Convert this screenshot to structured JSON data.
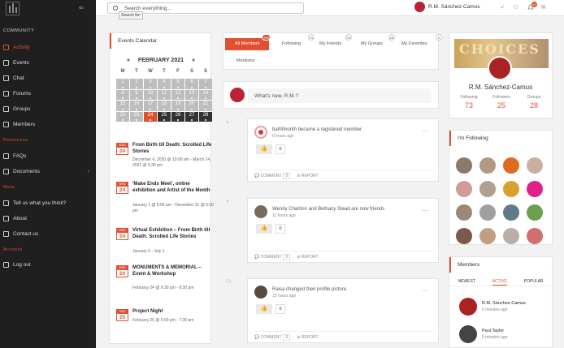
{
  "sidebar": {
    "sections": {
      "community": "COMMUNITY",
      "resources": "Resources",
      "more": "More",
      "account": "Account"
    },
    "items": [
      {
        "label": "Activity",
        "icon": "activity-icon"
      },
      {
        "label": "Events",
        "icon": "calendar-icon"
      },
      {
        "label": "Chat",
        "icon": "chat-icon"
      },
      {
        "label": "Forums",
        "icon": "forums-icon"
      },
      {
        "label": "Groups",
        "icon": "groups-icon"
      },
      {
        "label": "Members",
        "icon": "members-icon"
      },
      {
        "label": "FAQs",
        "icon": "faq-icon"
      },
      {
        "label": "Documents",
        "icon": "folder-icon"
      },
      {
        "label": "Tell us what you think?",
        "icon": "feedback-icon"
      },
      {
        "label": "About",
        "icon": "info-icon"
      },
      {
        "label": "Contact us",
        "icon": "contact-icon"
      },
      {
        "label": "Log out",
        "icon": "logout-icon"
      }
    ],
    "documents_chevron": "›",
    "menu_icon": "⇐"
  },
  "topbar": {
    "search_placeholder": "Search everything...",
    "tooltip": "Search for:",
    "user_name": "R.M. Sánchez-Camus",
    "notifications_badge": "42",
    "icons": {
      "check": "✓",
      "users": "⚇",
      "bell": "🔔",
      "mail": "✉"
    }
  },
  "calendar": {
    "title": "Events Calendar",
    "month": "FEBRUARY 2021",
    "prev": "«",
    "next": "»",
    "dow": [
      "M",
      "T",
      "W",
      "T",
      "F",
      "S",
      "S"
    ],
    "days": [
      "1",
      "2",
      "3",
      "4",
      "5",
      "6",
      "7",
      "8",
      "9",
      "10",
      "11",
      "12",
      "13",
      "14",
      "15",
      "16",
      "17",
      "18",
      "19",
      "20",
      "21",
      "22",
      "23",
      "24",
      "25",
      "26",
      "27",
      "28"
    ],
    "today": "24"
  },
  "events": [
    {
      "dw": "WED",
      "dn": "24",
      "title": "From Birth till Death: Scrolled Life Stories",
      "time": "December 6, 2020 @ 10:00 am - March 14, 2021 @ 5:30 pm"
    },
    {
      "dw": "WED",
      "dn": "24",
      "title": "'Make Ends Meet', online exhibition and Artist of the Month",
      "time": "January 1 @ 8:00 am - December 31 @ 5:00 pm"
    },
    {
      "dw": "WED",
      "dn": "24",
      "title": "Virtual Exhibition – From Birth till Death: Scrolled Life Stories",
      "time": "January 5 - July 1"
    },
    {
      "dw": "WED",
      "dn": "24",
      "title": "MONUMENTS & MEMORIAL – Event & Workshop",
      "time": "February 24 @ 6:30 pm - 8:30 pm"
    },
    {
      "dw": "THU",
      "dn": "25",
      "title": "Project Night",
      "time": "February 25 @ 6:00 pm - 7:30 pm"
    }
  ],
  "tabs": [
    {
      "label": "All Members",
      "count": "399"
    },
    {
      "label": "Following",
      "count": "73"
    },
    {
      "label": "My Friends",
      "count": "76"
    },
    {
      "label": "My Groups",
      "count": "28"
    },
    {
      "label": "My Favorites",
      "count": "2"
    },
    {
      "label": "Mentions",
      "count": ""
    }
  ],
  "status_placeholder": "What's new, R.M.?",
  "feed": [
    {
      "text": "bathfmonth became a registered member",
      "time": "6 hours ago",
      "likes": "0",
      "comment": "COMMENT",
      "comment_count": "0",
      "report": "REPORT"
    },
    {
      "text": "Wendy Charlton and Bethany Stead are now friends",
      "time": "11 hours ago",
      "likes": "0",
      "comment": "COMMENT",
      "comment_count": "0",
      "report": "REPORT"
    },
    {
      "text": "Raisa changed their profile picture",
      "time": "13 hours ago",
      "likes": "0",
      "comment": "COMMENT",
      "comment_count": "0",
      "report": "REPORT"
    }
  ],
  "profile": {
    "cover_text": "CHOICES",
    "name": "R.M. Sánchez-Camus",
    "stats": [
      {
        "label": "Following",
        "value": "73"
      },
      {
        "label": "Followers",
        "value": "25"
      },
      {
        "label": "Groups",
        "value": "28"
      }
    ]
  },
  "following_title": "I'm Following",
  "following_colors": [
    "#8a7a6a",
    "#b09a80",
    "#e06a20",
    "#c8b0a0",
    "#d49a9a",
    "#b0a090",
    "#d9a030",
    "#e0208a",
    "#9a8a7a",
    "#a0a0a0",
    "#607a8a",
    "#6aa050",
    "#7a5a4a",
    "#c0a080",
    "#b8b0a8",
    "#d07070"
  ],
  "members": {
    "title": "Members",
    "tabs": [
      "NEWEST",
      "ACTIVE",
      "POPULAR"
    ],
    "list": [
      {
        "name": "R.M. Sánchez-Camus",
        "time": "5 minutes ago"
      },
      {
        "name": "Paul Taylor",
        "time": "5 minutes ago"
      }
    ]
  },
  "colors": {
    "accent": "#e05030",
    "sidebar": "#1f1f1f"
  }
}
